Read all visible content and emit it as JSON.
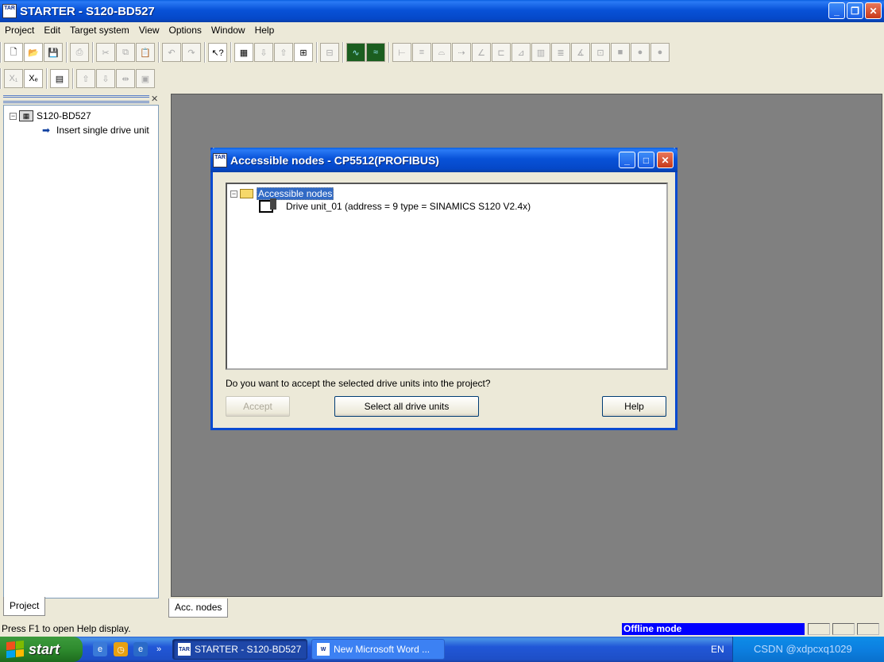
{
  "window": {
    "icon_text": "TAR",
    "title": "STARTER - S120-BD527"
  },
  "menubar": [
    "Project",
    "Edit",
    "Target system",
    "View",
    "Options",
    "Window",
    "Help"
  ],
  "project_tree": {
    "root": "S120-BD527",
    "child": "Insert single drive unit"
  },
  "left_tab": "Project",
  "workspace_tab": "Acc. nodes",
  "dialog": {
    "title": "Accessible nodes - CP5512(PROFIBUS)",
    "tree_root": "Accessible nodes",
    "node": "Drive unit_01 (address = 9 type = SINAMICS S120 V2.4x)",
    "question": "Do you want to accept the selected drive units into the project?",
    "accept_label": "Accept",
    "select_all_label": "Select all drive units",
    "help_label": "Help"
  },
  "statusbar": {
    "help_text": "Press F1 to open Help display.",
    "mode": "Offline mode"
  },
  "taskbar": {
    "start_label": "start",
    "tasks": [
      "STARTER - S120-BD527",
      "New Microsoft Word ..."
    ],
    "language": "EN",
    "watermark": "CSDN @xdpcxq1029"
  },
  "colors": {
    "titlebar": "#0852d8",
    "workspace": "#808080",
    "selection": "#316ac5",
    "offline_mode": "#0000ff"
  }
}
